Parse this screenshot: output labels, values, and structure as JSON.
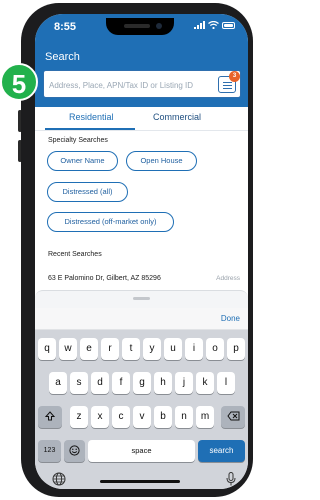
{
  "status_bar": {
    "time": "8:55"
  },
  "header": {
    "title": "Search"
  },
  "search": {
    "placeholder": "Address, Place, APN/Tax ID or Listing ID",
    "filter_badge": "3"
  },
  "tabs": [
    {
      "label": "Residential",
      "active": true
    },
    {
      "label": "Commercial",
      "active": false
    }
  ],
  "specialty": {
    "heading": "Specialty Searches",
    "chips": [
      "Owner Name",
      "Open House",
      "Distressed (all)",
      "Distressed (off-market only)"
    ]
  },
  "recent": {
    "heading": "Recent Searches",
    "items": [
      {
        "text": "63 E Palomino Dr, Gilbert, AZ 85296",
        "type": "Address"
      }
    ]
  },
  "keyboard": {
    "done_label": "Done",
    "row1": [
      "q",
      "w",
      "e",
      "r",
      "t",
      "y",
      "u",
      "i",
      "o",
      "p"
    ],
    "row2": [
      "a",
      "s",
      "d",
      "f",
      "g",
      "h",
      "j",
      "k",
      "l"
    ],
    "row3": [
      "z",
      "x",
      "c",
      "v",
      "b",
      "n",
      "m"
    ],
    "numbers_label": "123",
    "space_label": "space",
    "search_label": "search"
  },
  "step_badge": "5",
  "colors": {
    "brand_blue": "#1f6fb5",
    "badge_orange": "#e8632a",
    "step_green": "#22b14c"
  },
  "icons": [
    "filter-icon",
    "emoji-icon",
    "shift-icon",
    "delete-icon",
    "globe-icon",
    "microphone-icon"
  ]
}
